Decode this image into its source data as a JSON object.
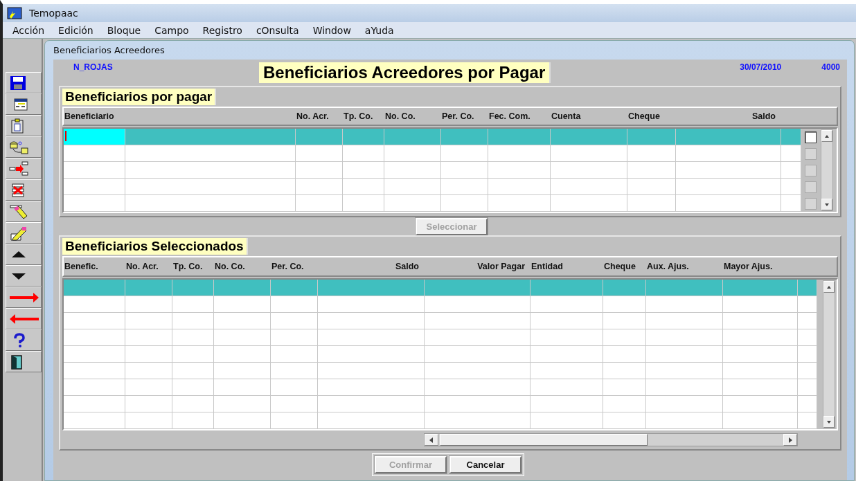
{
  "window": {
    "title": "Temopaac"
  },
  "menu": [
    "Acción",
    "Edición",
    "Bloque",
    "Campo",
    "Registro",
    "cOnsulta",
    "Window",
    "aYuda"
  ],
  "form": {
    "title": "Beneficiarios Acreedores",
    "user": "N_ROJAS",
    "heading": "Beneficiarios Acreedores por Pagar",
    "date": "30/07/2010",
    "code": "4000"
  },
  "pending": {
    "title": "Beneficiarios por pagar",
    "columns": [
      "Beneficiario",
      "No. Acr.",
      "Tp. Co.",
      "No. Co.",
      "Per. Co.",
      "Fec. Com.",
      "Cuenta",
      "Cheque",
      "Saldo"
    ],
    "rows": [
      {
        "selected": true,
        "focused": true,
        "checked": false,
        "disabled": false
      },
      {
        "selected": false,
        "focused": false,
        "checked": false,
        "disabled": true
      },
      {
        "selected": false,
        "focused": false,
        "checked": false,
        "disabled": true
      },
      {
        "selected": false,
        "focused": false,
        "checked": false,
        "disabled": true
      },
      {
        "selected": false,
        "focused": false,
        "checked": false,
        "disabled": true
      }
    ],
    "button": {
      "label": "Seleccionar",
      "disabled": true
    }
  },
  "selected_list": {
    "title": "Beneficiarios Seleccionados",
    "columns": [
      "Benefic.",
      "No. Acr.",
      "Tp. Co.",
      "No. Co.",
      "Per. Co.",
      "Saldo",
      "Valor Pagar",
      "Entidad",
      "Cheque",
      "Aux. Ajus.",
      "Mayor Ajus."
    ],
    "rows": [
      {
        "selected": true
      },
      {
        "selected": false
      },
      {
        "selected": false
      },
      {
        "selected": false
      },
      {
        "selected": false
      },
      {
        "selected": false
      },
      {
        "selected": false
      },
      {
        "selected": false
      },
      {
        "selected": false
      }
    ]
  },
  "buttons": [
    {
      "label": "Confirmar",
      "disabled": true
    },
    {
      "label": "Cancelar",
      "disabled": false
    }
  ]
}
